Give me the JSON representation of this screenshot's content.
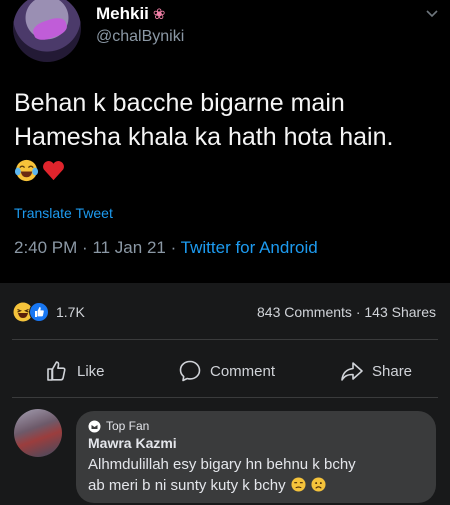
{
  "tweet": {
    "display_name": "Mehkii",
    "name_emoji": "❀",
    "handle": "@chalByniki",
    "text_line1": "Behan k bacche bigarne main",
    "text_line2": "Hamesha khala ka hath hota hain.",
    "emojis": [
      "face-with-tears-of-joy-emoji",
      "red-heart-emoji"
    ],
    "translate_label": "Translate Tweet",
    "time": "2:40 PM",
    "date": "11 Jan 21",
    "source": "Twitter for Android"
  },
  "facebook": {
    "reaction_count": "1.7K",
    "comments": "843 Comments",
    "shares": "143 Shares",
    "actions": {
      "like": "Like",
      "comment": "Comment",
      "share": "Share"
    },
    "comment": {
      "badge": "Top Fan",
      "author": "Mawra Kazmi",
      "line1": "Alhmdulillah esy bigary hn behnu k bchy",
      "line2": "ab meri b ni sunty kuty k bchy"
    }
  },
  "colors": {
    "accent_blue": "#1d9bf0",
    "muted": "#8b98a5",
    "fb_bg": "#18191a",
    "bubble": "#3a3b3c"
  }
}
